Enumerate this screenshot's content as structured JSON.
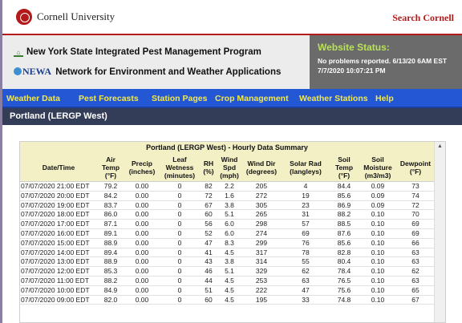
{
  "cornell": {
    "name": "Cornell University",
    "search_label": "Search Cornell"
  },
  "header": {
    "program": "New York State Integrated Pest Management Program",
    "newa_logo": "NEWA",
    "newa_title": "Network for Environment and Weather Applications",
    "status_title": "Website Status:",
    "status_message": "No problems reported. 6/13/20 6AM EST",
    "status_time": "7/7/2020 10:07:21 PM"
  },
  "nav": {
    "items": [
      "Weather Data",
      "Pest Forecasts",
      "Station Pages",
      "Crop Management",
      "Weather Stations",
      "Help"
    ]
  },
  "station": {
    "name": "Portland (LERGP West)"
  },
  "table": {
    "title": "Portland (LERGP West) - Hourly Data Summary",
    "headers": [
      [
        "Date/Time"
      ],
      [
        "Air",
        "Temp",
        "(°F)"
      ],
      [
        "Precip",
        "(inches)"
      ],
      [
        "Leaf",
        "Wetness",
        "(minutes)"
      ],
      [
        "RH",
        "(%)"
      ],
      [
        "Wind",
        "Spd",
        "(mph)"
      ],
      [
        "Wind Dir",
        "(degrees)"
      ],
      [
        "Solar Rad",
        "(langleys)"
      ],
      [
        "Soil",
        "Temp",
        "(°F)"
      ],
      [
        "Soil",
        "Moisture",
        "(m3/m3)"
      ],
      [
        "Dewpoint",
        "(°F)"
      ]
    ],
    "rows": [
      [
        "07/07/2020 21:00 EDT",
        "79.2",
        "0.00",
        "0",
        "82",
        "2.2",
        "205",
        "4",
        "84.4",
        "0.09",
        "73"
      ],
      [
        "07/07/2020 20:00 EDT",
        "84.2",
        "0.00",
        "0",
        "72",
        "1.6",
        "272",
        "19",
        "85.6",
        "0.09",
        "74"
      ],
      [
        "07/07/2020 19:00 EDT",
        "83.7",
        "0.00",
        "0",
        "67",
        "3.8",
        "305",
        "23",
        "86.9",
        "0.09",
        "72"
      ],
      [
        "07/07/2020 18:00 EDT",
        "86.0",
        "0.00",
        "0",
        "60",
        "5.1",
        "265",
        "31",
        "88.2",
        "0.10",
        "70"
      ],
      [
        "07/07/2020 17:00 EDT",
        "87.1",
        "0.00",
        "0",
        "56",
        "6.0",
        "298",
        "57",
        "88.5",
        "0.10",
        "69"
      ],
      [
        "07/07/2020 16:00 EDT",
        "89.1",
        "0.00",
        "0",
        "52",
        "6.0",
        "274",
        "69",
        "87.6",
        "0.10",
        "69"
      ],
      [
        "07/07/2020 15:00 EDT",
        "88.9",
        "0.00",
        "0",
        "47",
        "8.3",
        "299",
        "76",
        "85.6",
        "0.10",
        "66"
      ],
      [
        "07/07/2020 14:00 EDT",
        "89.4",
        "0.00",
        "0",
        "41",
        "4.5",
        "317",
        "78",
        "82.8",
        "0.10",
        "63"
      ],
      [
        "07/07/2020 13:00 EDT",
        "88.9",
        "0.00",
        "0",
        "43",
        "3.8",
        "314",
        "55",
        "80.4",
        "0.10",
        "63"
      ],
      [
        "07/07/2020 12:00 EDT",
        "85.3",
        "0.00",
        "0",
        "46",
        "5.1",
        "329",
        "62",
        "78.4",
        "0.10",
        "62"
      ],
      [
        "07/07/2020 11:00 EDT",
        "88.2",
        "0.00",
        "0",
        "44",
        "4.5",
        "253",
        "63",
        "76.5",
        "0.10",
        "63"
      ],
      [
        "07/07/2020 10:00 EDT",
        "84.9",
        "0.00",
        "0",
        "51",
        "4.5",
        "222",
        "47",
        "75.6",
        "0.10",
        "65"
      ],
      [
        "07/07/2020 09:00 EDT",
        "82.0",
        "0.00",
        "0",
        "60",
        "4.5",
        "195",
        "33",
        "74.8",
        "0.10",
        "67"
      ]
    ]
  }
}
